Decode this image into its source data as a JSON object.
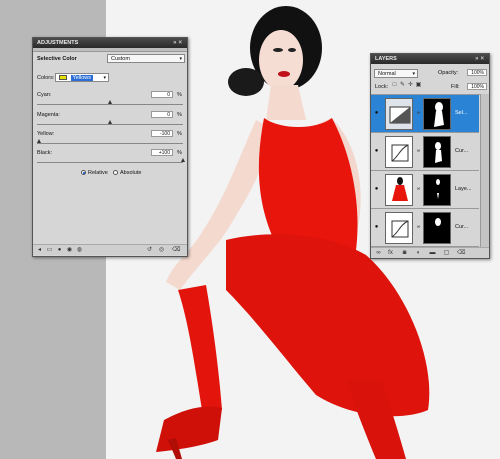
{
  "adjustments": {
    "title": "ADJUSTMENTS",
    "tab_label": "Selective Color",
    "preset_value": "Custom",
    "colors_label": "Colors:",
    "colors_value": "Yellows",
    "colors_swatch": "#e8e000",
    "sliders": [
      {
        "label": "Cyan:",
        "value": "0",
        "unit": "%",
        "position": 0.5
      },
      {
        "label": "Magenta:",
        "value": "0",
        "unit": "%",
        "position": 0.5
      },
      {
        "label": "Yellow:",
        "value": "-100",
        "unit": "%",
        "position": 0.0
      },
      {
        "label": "Black:",
        "value": "+100",
        "unit": "%",
        "position": 1.0
      }
    ],
    "method_options": [
      {
        "label": "Relative",
        "selected": true
      },
      {
        "label": "Absolute",
        "selected": false
      }
    ]
  },
  "layers": {
    "title": "LAYERS",
    "blend_mode": "Normal",
    "opacity_label": "Opacity:",
    "opacity_value": "100%",
    "lock_label": "Lock:",
    "fill_label": "Fill:",
    "fill_value": "100%",
    "rows": [
      {
        "name": "Sel...",
        "selected": true,
        "thumb": "adjustment"
      },
      {
        "name": "Cur...",
        "selected": false,
        "thumb": "curves"
      },
      {
        "name": "Laye...",
        "selected": false,
        "thumb": "photo"
      },
      {
        "name": "Cur...",
        "selected": false,
        "thumb": "curves"
      }
    ]
  },
  "colors": {
    "dress": "#e8150c",
    "selection": "#2b83d6"
  }
}
